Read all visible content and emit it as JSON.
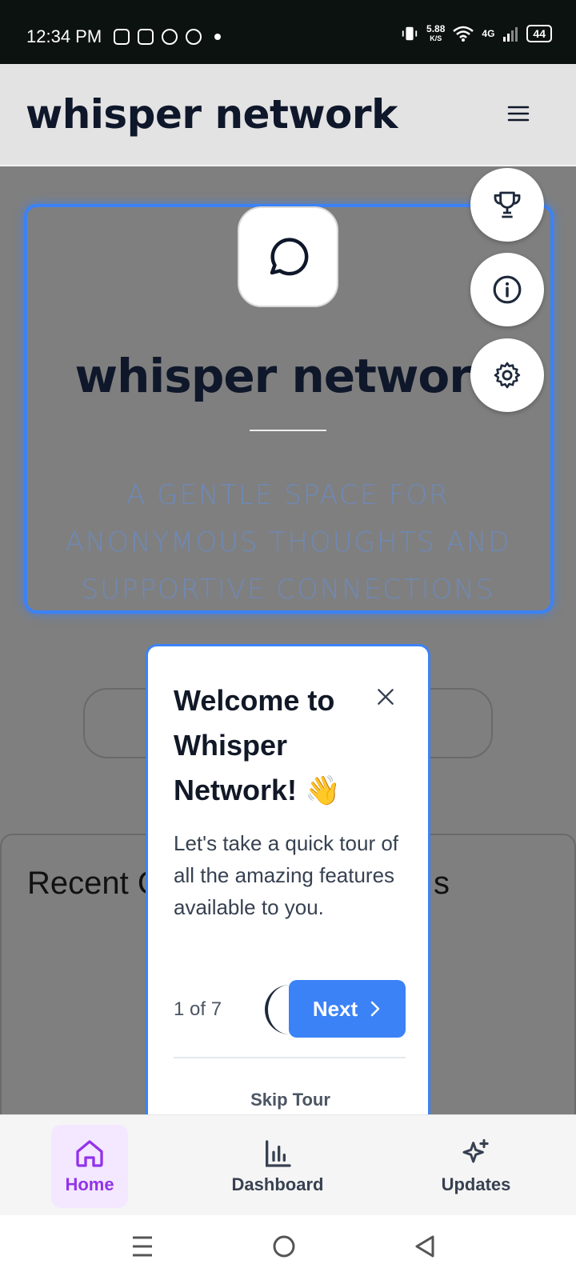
{
  "status_bar": {
    "time": "12:34 PM",
    "net_speed_value": "5.88",
    "net_speed_unit": "K/S",
    "network": "4G",
    "battery": "44"
  },
  "app_bar": {
    "title": "whisper network"
  },
  "hero": {
    "title": "whisper network",
    "subtitle": "A GENTLE SPACE FOR ANONYMOUS THOUGHTS AND SUPPORTIVE CONNECTIONS"
  },
  "fabs": {
    "trophy": "trophy-icon",
    "info": "info-icon",
    "settings": "gear-icon"
  },
  "recent": {
    "title_left": "Recent C",
    "title_right": "s"
  },
  "tour": {
    "title": "Welcome to Whisper Network! 👋",
    "body": "Let's take a quick tour of all the amazing features available to you.",
    "step": "1 of 7",
    "next_label": "Next",
    "skip_label": "Skip Tour"
  },
  "bottom_nav": {
    "items": [
      {
        "label": "Home",
        "icon": "home-icon",
        "active": true
      },
      {
        "label": "Dashboard",
        "icon": "bar-chart-icon",
        "active": false
      },
      {
        "label": "Updates",
        "icon": "sparkles-icon",
        "active": false
      }
    ]
  },
  "colors": {
    "accent": "#3b82f6",
    "active_nav": "#9333ea",
    "active_nav_bg": "#f3e8ff",
    "title": "#0f172a"
  }
}
